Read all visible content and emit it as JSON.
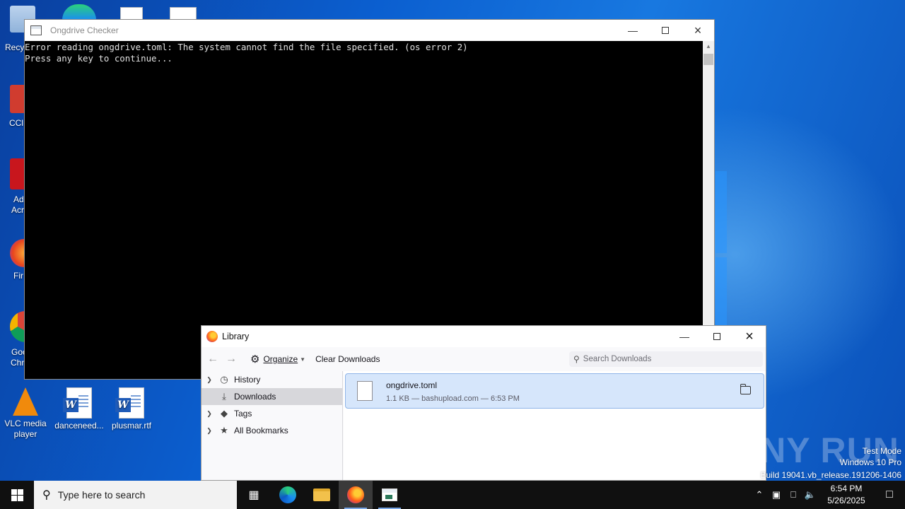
{
  "desktop": {
    "partial_labels": [
      "Recy",
      "CCl",
      "Ad",
      "Acr",
      "Fir",
      "Goo",
      "Chr"
    ],
    "icons": [
      {
        "label_line1": "VLC media",
        "label_line2": "player"
      },
      {
        "label_line1": "danceneed...",
        "label_line2": ""
      },
      {
        "label_line1": "plusmar.rtf",
        "label_line2": ""
      }
    ]
  },
  "console": {
    "title": "Ongdrive Checker",
    "lines": [
      "Error reading ongdrive.toml: The system cannot find the file specified. (os error 2)",
      "Press any key to continue..."
    ]
  },
  "library": {
    "title": "Library",
    "toolbar": {
      "organize_label": "Organize",
      "clear_label": "Clear Downloads",
      "search_placeholder": "Search Downloads"
    },
    "sidebar": [
      {
        "label": "History",
        "icon": "clock-icon",
        "expandable": true
      },
      {
        "label": "Downloads",
        "icon": "download-icon",
        "expandable": false,
        "selected": true
      },
      {
        "label": "Tags",
        "icon": "tag-icon",
        "expandable": true
      },
      {
        "label": "All Bookmarks",
        "icon": "star-icon",
        "expandable": true
      }
    ],
    "download": {
      "filename": "ongdrive.toml",
      "meta": "1.1 KB — bashupload.com — 6:53 PM"
    }
  },
  "watermark": {
    "brand": "ANY RUN",
    "lines": [
      "Test Mode",
      "Windows 10 Pro",
      "Build 19041.vb_release.191206-1406"
    ]
  },
  "taskbar": {
    "search_placeholder": "Type here to search",
    "time": "6:54 PM",
    "date": "5/26/2025"
  },
  "colors": {
    "selection": "#d6e6fb",
    "taskbar": "#101010",
    "console_bg": "#000000"
  }
}
